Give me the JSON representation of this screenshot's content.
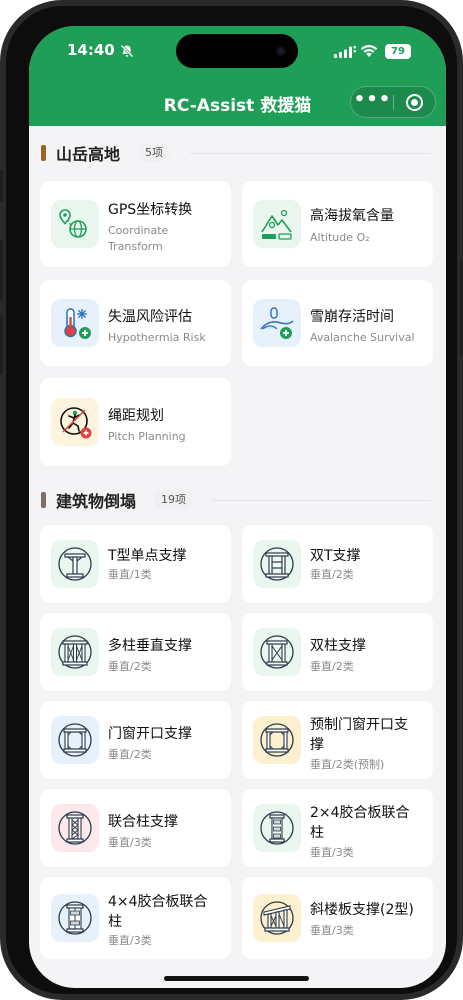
{
  "status": {
    "time": "14:40",
    "battery": "79"
  },
  "header": {
    "title": "RC-Assist 救援猫",
    "more_icon": "•••"
  },
  "sections": [
    {
      "title": "山岳高地",
      "count": "5项",
      "bar_color": "#9c6428",
      "cards": [
        {
          "title": "GPS坐标转换",
          "subtitle_line1": "Coordinate",
          "subtitle_line2": "Transform",
          "icon": "globe-gps-icon"
        },
        {
          "title": "高海拔氧含量",
          "subtitle_line1": "Altitude O₂",
          "icon": "mountain-altitude-icon"
        },
        {
          "title": "失温风险评估",
          "subtitle_line1": "Hypothermia Risk",
          "icon": "thermometer-icon"
        },
        {
          "title": "雪崩存活时间",
          "subtitle_line1": "Avalanche Survival",
          "icon": "avalanche-icon"
        },
        {
          "title": "绳距规划",
          "subtitle_line1": "Pitch Planning",
          "icon": "climber-rope-icon"
        }
      ]
    },
    {
      "title": "建筑物倒塌",
      "count": "19项",
      "bar_color": "#7d6f66",
      "cards": [
        {
          "title": "T型单点支撑",
          "subtitle_line1": "垂直/1类",
          "icon": "t-shore-icon"
        },
        {
          "title": "双T支撑",
          "subtitle_line1": "垂直/2类",
          "icon": "double-t-shore-icon"
        },
        {
          "title": "多柱垂直支撑",
          "subtitle_line1": "垂直/2类",
          "icon": "multi-post-shore-icon"
        },
        {
          "title": "双柱支撑",
          "subtitle_line1": "垂直/2类",
          "icon": "two-post-shore-icon"
        },
        {
          "title": "门窗开口支撑",
          "subtitle_line1": "垂直/2类",
          "icon": "window-shore-icon"
        },
        {
          "title": "预制门窗开口支",
          "title_line2": "撑",
          "subtitle_line1": "垂直/2类(预制)",
          "icon": "prefab-window-shore-icon"
        },
        {
          "title": "联合柱支撑",
          "subtitle_line1": "垂直/3类",
          "icon": "combined-post-icon"
        },
        {
          "title": "2×4胶合板联合",
          "title_line2": "柱",
          "subtitle_line1": "垂直/3类",
          "icon": "plywood-laced-post-icon"
        },
        {
          "title": "4×4胶合板联合",
          "title_line2": "柱",
          "subtitle_line1": "垂直/3类",
          "icon": "plywood-laced-4x4-icon"
        },
        {
          "title": "斜楼板支撑(2型)",
          "subtitle_line1": "垂直/3类",
          "icon": "sloped-floor-shore-icon"
        }
      ]
    }
  ],
  "colors": {
    "brand_green": "#1f9e57",
    "background": "#f4f4f6"
  }
}
